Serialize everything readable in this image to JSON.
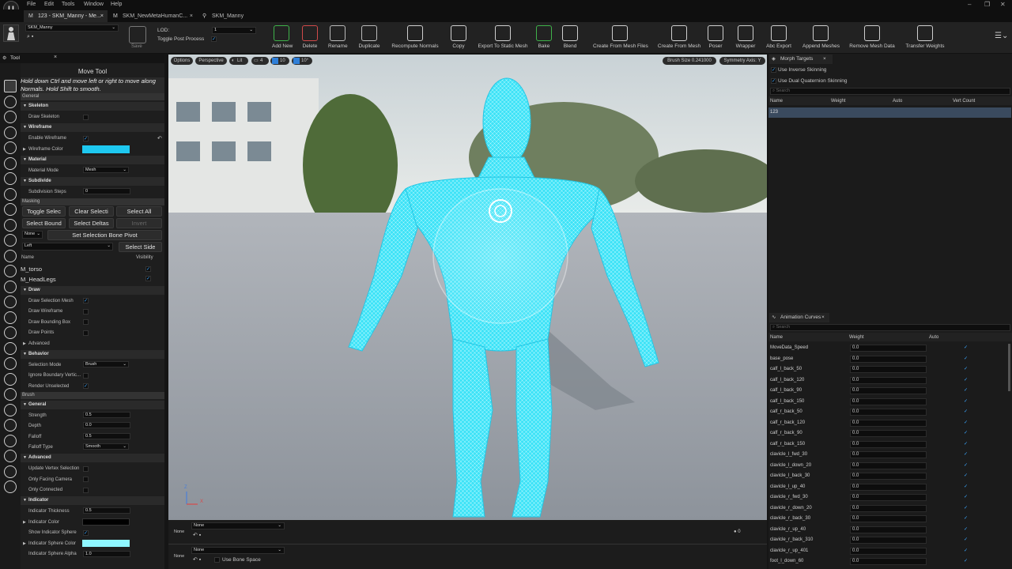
{
  "menu": [
    "File",
    "Edit",
    "Tools",
    "Window",
    "Help"
  ],
  "tabs": [
    {
      "label": "123 - SKM_Manny - Me...",
      "active": true,
      "close": "×"
    },
    {
      "label": "SKM_NewMetaHumanC...",
      "active": false,
      "close": "×"
    },
    {
      "label": "SKM_Manny",
      "active": false,
      "close": ""
    }
  ],
  "asset_selector": "SKM_Manny",
  "lod": {
    "label": "LOD:",
    "value": "1",
    "toggle_post_process": "Toggle Post Process"
  },
  "save_label": "Save",
  "toolbar_buttons": [
    {
      "label": "Add New",
      "color": "#3fb24a"
    },
    {
      "label": "Delete",
      "color": "#d14a4a"
    },
    {
      "label": "Rename",
      "color": "#bbbbbb"
    },
    {
      "label": "Duplicate",
      "color": "#bbbbbb"
    },
    {
      "label": "Recompute Normals",
      "color": "#cfcfcf"
    },
    {
      "label": "Copy",
      "color": "#cfcfcf"
    },
    {
      "label": "Export To Static Mesh",
      "color": "#cfcfcf"
    },
    {
      "label": "Bake",
      "color": "#3fb24a"
    },
    {
      "label": "Blend",
      "color": "#cfcfcf"
    },
    {
      "label": "Create From Mesh Files",
      "color": "#cfcfcf"
    },
    {
      "label": "Create From Mesh",
      "color": "#cfcfcf"
    },
    {
      "label": "Poser",
      "color": "#cfcfcf"
    },
    {
      "label": "Wrapper",
      "color": "#cfcfcf"
    },
    {
      "label": "Abc Export",
      "color": "#cfcfcf"
    },
    {
      "label": "Append Meshes",
      "color": "#cfcfcf"
    },
    {
      "label": "Remove Mesh Data",
      "color": "#cfcfcf"
    },
    {
      "label": "Transfer Weights",
      "color": "#cfcfcf"
    }
  ],
  "tool_panel": {
    "tab": "Tool",
    "title": "Move Tool",
    "hint": "Hold down Ctrl and move left or right to move along Normals. Hold Shift to smooth.",
    "general": "General",
    "skeleton": "Skeleton",
    "draw_skeleton": "Draw Skeleton",
    "wireframe": "Wireframe",
    "enable_wireframe": "Enable Wireframe",
    "wireframe_color_label": "Wireframe Color",
    "wireframe_color": "#1ec8f0",
    "material": "Material",
    "material_mode_label": "Material Mode",
    "material_mode": "Mesh",
    "subdivide": "Subdivide",
    "subdivision_steps_label": "Subdivision Steps",
    "subdivision_steps": "0",
    "masking": "Masking",
    "btn_toggle": "Toggle Selec",
    "btn_clear": "Clear Selecti",
    "btn_select_all": "Select All",
    "btn_select_bound": "Select Bound",
    "btn_select_deltas": "Select Deltas",
    "btn_invert": "Invert",
    "bone_dropdown": "None",
    "btn_bone_pivot": "Set Selection Bone Pivot",
    "side_dropdown": "Left",
    "btn_select_side": "Select Side",
    "col_name": "Name",
    "col_visibility": "Visibility",
    "materials": [
      "M_torso",
      "M_HeadLegs"
    ],
    "draw": "Draw",
    "draw_selection_mesh": "Draw Selection Mesh",
    "draw_wireframe": "Draw Wireframe",
    "draw_bounding_box": "Draw Bounding Box",
    "draw_points": "Draw Points",
    "advanced": "Advanced",
    "behavior": "Behavior",
    "selection_mode_label": "Selection Mode",
    "selection_mode": "Brush",
    "ignore_boundary": "Ignore Boundary Vertic...",
    "render_unselected": "Render Unselected",
    "brush": "Brush",
    "brush_general": "General",
    "strength_label": "Strength",
    "strength": "0.5",
    "depth_label": "Depth",
    "depth": "0.0",
    "falloff_label": "Falloff",
    "falloff": "0.5",
    "falloff_type_label": "Falloff Type",
    "falloff_type": "Smooth",
    "advanced2": "Advanced",
    "update_vertex": "Update Vertex Selection",
    "only_facing": "Only Facing Camera",
    "only_connected": "Only Connected",
    "indicator": "Indicator",
    "indicator_thickness_label": "Indicator Thickness",
    "indicator_thickness": "0.5",
    "indicator_color_label": "Indicator Color",
    "indicator_color": "#000000",
    "show_indicator_sphere": "Show Indicator Sphere",
    "indicator_sphere_color_label": "Indicator Sphere Color",
    "indicator_sphere_color": "#8ff6ff",
    "indicator_sphere_alpha_label": "Indicator Sphere Alpha",
    "indicator_sphere_alpha": "1.0"
  },
  "viewport": {
    "options": "Options",
    "perspective": "Perspective",
    "lit": "Lit",
    "cam_speed": "4",
    "grid": "10",
    "rot": "10°",
    "brush_size": "Brush Size 0.241000",
    "symmetry": "Symmetry  Axis: Y",
    "axis_z": "Z",
    "axis_x": "X"
  },
  "bottom": {
    "none1": "None",
    "dd1": "None",
    "none2": "None",
    "dd2": "None",
    "use_bone_space": "Use Bone Space",
    "zero": "0"
  },
  "morph_targets": {
    "title": "Morph Targets",
    "use_inverse": "Use Inverse Skinning",
    "use_dual": "Use Dual Quaternion Skinning",
    "search": "Search",
    "cols": [
      "Name",
      "Weight",
      "Auto",
      "Vert Count"
    ],
    "rows": [
      "123"
    ]
  },
  "anim_curves": {
    "title": "Animation Curves",
    "search": "Search",
    "cols": [
      "Name",
      "Weight",
      "Auto"
    ],
    "rows": [
      {
        "name": "MoveData_Speed",
        "w": "0.0"
      },
      {
        "name": "base_pose",
        "w": "0.0"
      },
      {
        "name": "calf_l_back_50",
        "w": "0.0"
      },
      {
        "name": "calf_l_back_120",
        "w": "0.0"
      },
      {
        "name": "calf_l_back_90",
        "w": "0.0"
      },
      {
        "name": "calf_l_back_150",
        "w": "0.0"
      },
      {
        "name": "calf_r_back_50",
        "w": "0.0"
      },
      {
        "name": "calf_r_back_120",
        "w": "0.0"
      },
      {
        "name": "calf_r_back_90",
        "w": "0.0"
      },
      {
        "name": "calf_r_back_150",
        "w": "0.0"
      },
      {
        "name": "clavicle_l_fwd_30",
        "w": "0.0"
      },
      {
        "name": "clavicle_l_down_20",
        "w": "0.0"
      },
      {
        "name": "clavicle_l_back_30",
        "w": "0.0"
      },
      {
        "name": "clavicle_l_up_40",
        "w": "0.0"
      },
      {
        "name": "clavicle_r_fwd_30",
        "w": "0.0"
      },
      {
        "name": "clavicle_r_down_20",
        "w": "0.0"
      },
      {
        "name": "clavicle_r_back_30",
        "w": "0.0"
      },
      {
        "name": "clavicle_r_up_40",
        "w": "0.0"
      },
      {
        "name": "clavicle_r_back_310",
        "w": "0.0"
      },
      {
        "name": "clavicle_r_up_401",
        "w": "0.0"
      },
      {
        "name": "foot_l_down_60",
        "w": "0.0"
      }
    ]
  }
}
